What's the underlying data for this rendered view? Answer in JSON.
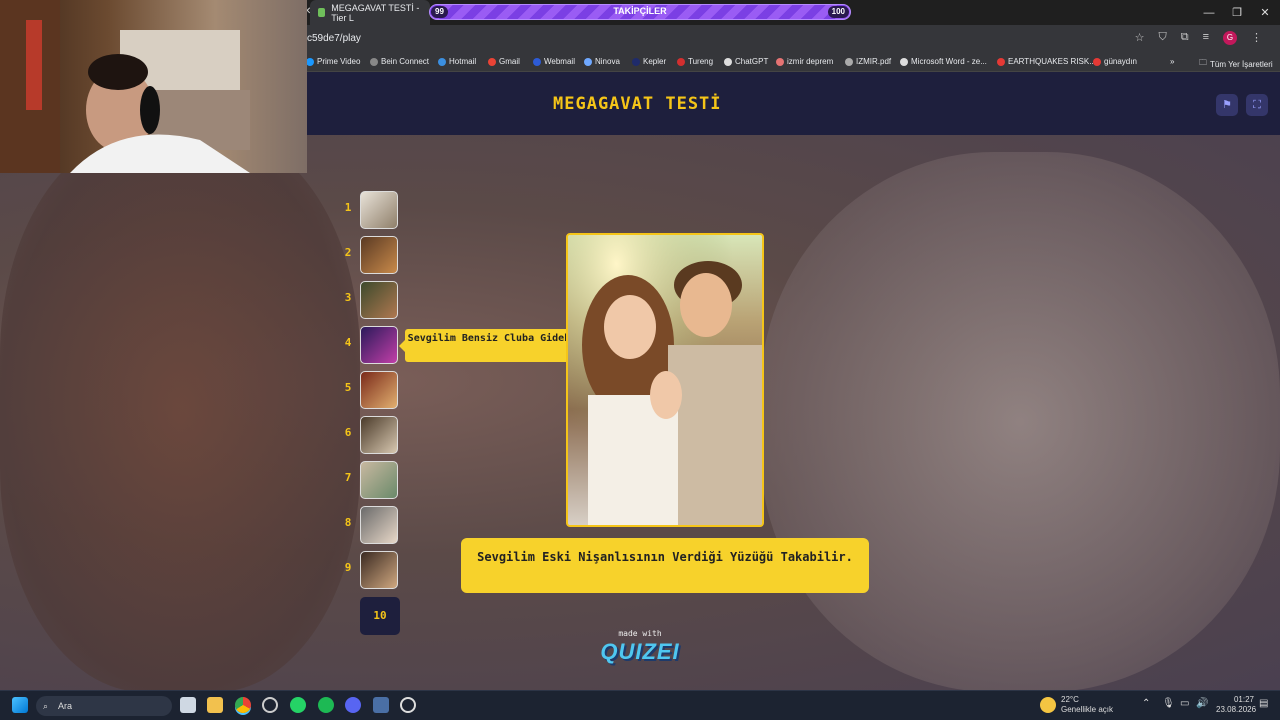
{
  "browser": {
    "tab_title": "MEGAGAVAT TESTİ - Tier L",
    "url": "c59de7/play",
    "bookmarks": [
      "Prime Video",
      "Bein Connect",
      "Hotmail",
      "Gmail",
      "Webmail",
      "Ninova",
      "Kepler",
      "Tureng",
      "ChatGPT",
      "izmir deprem",
      "IZMIR.pdf",
      "Microsoft Word - ze...",
      "EARTHQUAKES RISK...",
      "günaydın"
    ],
    "all_bookmarks": "Tüm Yer İşaretleri",
    "more_bookmarks": "»",
    "profile_initial": "G"
  },
  "stream_overlay": {
    "label": "TAKİPÇİLER",
    "current": "99",
    "goal": "100",
    "progress": 0.99
  },
  "quiz": {
    "title": "MEGAGAVAT TESTİ",
    "ranks": [
      "1",
      "2",
      "3",
      "4",
      "5",
      "6",
      "7",
      "8",
      "9"
    ],
    "empty_slot": "10",
    "tooltip": "Sevgilim Bensiz Cluba Gidebilir.",
    "question": "Sevgilim Eski Nişanlısının Verdiği Yüzüğü Takabilir.",
    "made_with": "made with",
    "brand": "QUIZEI"
  },
  "taskbar": {
    "search_placeholder": "Ara",
    "weather_temp": "22°C",
    "weather_desc": "Genellikle açık",
    "time": "01:27",
    "date": "23.08.2026"
  },
  "colors": {
    "accent_yellow": "#f7d22b",
    "header_navy": "#1e1f3d",
    "progress_purple": "#8a4cf0"
  }
}
